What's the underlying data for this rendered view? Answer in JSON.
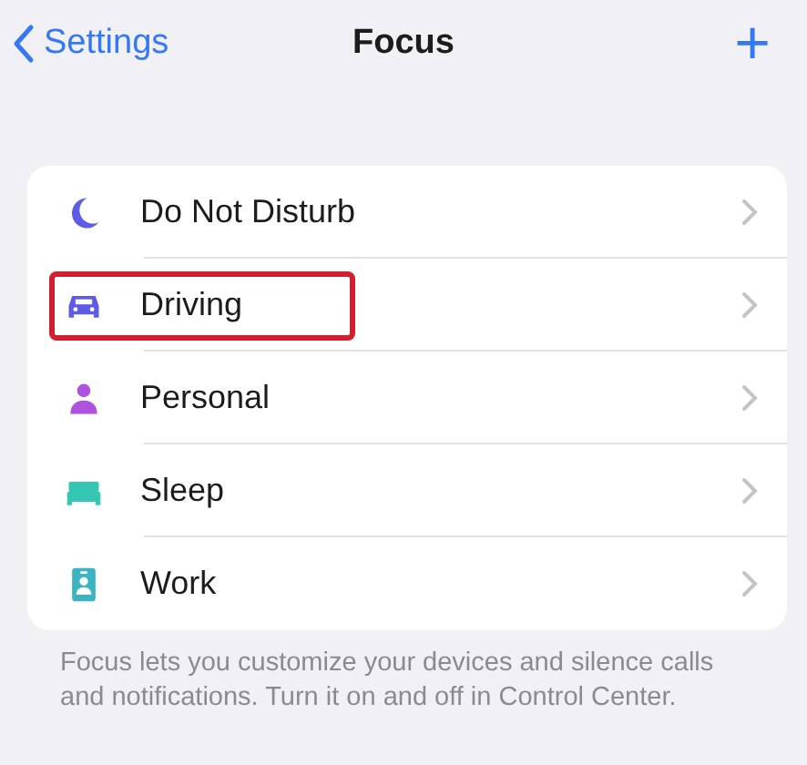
{
  "nav": {
    "back": "Settings",
    "title": "Focus",
    "add": "+"
  },
  "items": [
    {
      "label": "Do Not Disturb",
      "kind": "moon",
      "color": "#5e5ce6",
      "highlighted": false
    },
    {
      "label": "Driving",
      "kind": "car",
      "color": "#5e5ce6",
      "highlighted": true
    },
    {
      "label": "Personal",
      "kind": "person",
      "color": "#af52de",
      "highlighted": false
    },
    {
      "label": "Sleep",
      "kind": "bed",
      "color": "#35c7b4",
      "highlighted": false
    },
    {
      "label": "Work",
      "kind": "badge",
      "color": "#3bb3c3",
      "highlighted": false
    }
  ],
  "footer": "Focus lets you customize your devices and silence calls and notifications. Turn it on and off in Control Center."
}
